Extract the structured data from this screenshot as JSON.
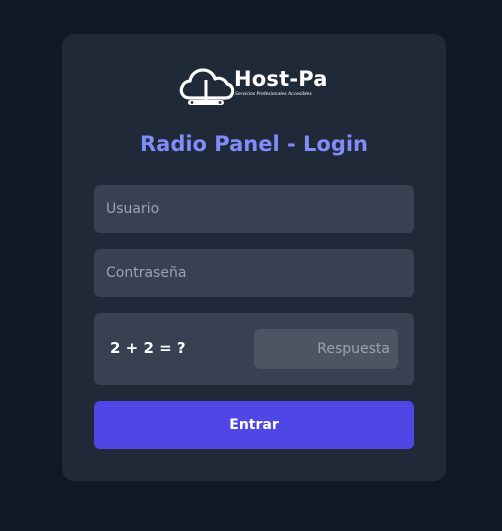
{
  "brand": {
    "name": "Host-Pa",
    "tagline": "Servicios Profesionales Accesibles",
    "icon": "cloud-server-icon"
  },
  "title": "Radio Panel - Login",
  "form": {
    "username": {
      "placeholder": "Usuario",
      "value": ""
    },
    "password": {
      "placeholder": "Contraseña",
      "value": ""
    },
    "captcha": {
      "question": "2 + 2 = ?",
      "placeholder": "Respuesta",
      "value": ""
    },
    "submit_label": "Entrar"
  },
  "colors": {
    "page_bg": "#101828",
    "card_bg": "#1f2937",
    "input_bg": "#374151",
    "title": "#818cf8",
    "accent": "#4f46e5"
  }
}
